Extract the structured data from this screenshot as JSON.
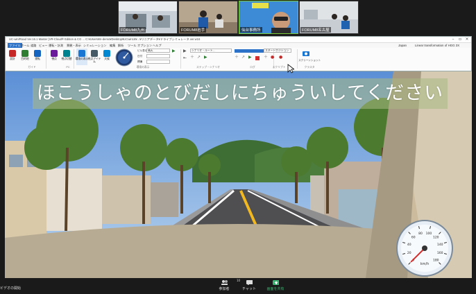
{
  "participants": [
    {
      "name": "FORUM8九州",
      "active": false
    },
    {
      "name": "FORUM8岩手",
      "active": false
    },
    {
      "name": "仙台事務所",
      "active": true
    },
    {
      "name": "FORUM8名古屋",
      "active": false
    }
  ],
  "app": {
    "title": "UC-win/Road Ver.16.1 Master [VR-Cloud® Edition & CG ... C:¥Users¥m-demo¥Desktop¥UCwin16¥...¥リニアデータ¥ドライブシミュレータ.ver.w16",
    "menu": [
      "ファイル",
      "ホーム",
      "道路",
      "ビュー",
      "運転・計測",
      "景観・表示",
      "シミュレーション",
      "編集",
      "解析",
      "ツール",
      "オプション",
      "ヘルプ"
    ],
    "selected_menu": "ファイル",
    "right_meta": {
      "lang": "Japan",
      "note": "Linear transformation of HGG 3X"
    },
    "ribbon": {
      "buttons": [
        {
          "label": "設計",
          "color": "#c62828"
        },
        {
          "label": "目的地",
          "color": "#2e7d32"
        },
        {
          "label": "運転",
          "color": "#1565c0"
        },
        {
          "label": "視点",
          "color": "#6a1b9a"
        },
        {
          "label": "視点切替",
          "color": "#00838f"
        },
        {
          "label": "交通",
          "color": "#ef6c00"
        },
        {
          "label": "環境の表示",
          "color": "#1976d2"
        },
        {
          "label": "視点アイテム",
          "color": "#455a64"
        },
        {
          "label": "天候",
          "color": "#0288d1"
        }
      ],
      "groups": [
        "ガイド",
        "PC",
        "環境の表示",
        "ステップ・シナリオ",
        "ログ",
        "スクリプト",
        "クラスタ"
      ],
      "fields": {
        "f1_label": "ビル表示",
        "f1_value": "晴天",
        "f2_label": "日付",
        "f2_value": "",
        "f3_label": "標識",
        "f3_value": "",
        "dropdown1": "シナリオ・ルート...",
        "dropdown2": "スタートポジション"
      },
      "right_button": "スクリーンショット"
    }
  },
  "scene": {
    "banner": "ほこうしゃのとびだしにちゅういしてください",
    "speedometer": {
      "unit": "km/h",
      "ticks": [
        "0",
        "20",
        "40",
        "60",
        "80",
        "100",
        "120",
        "140",
        "160",
        "180"
      ],
      "speed": 0
    }
  },
  "zoom": {
    "left_label": "ビデオの開始",
    "participants_count": "10",
    "items": [
      {
        "label": "参加者",
        "icon": "participants-icon"
      },
      {
        "label": "チャット",
        "icon": "chat-icon"
      },
      {
        "label": "画面を共有",
        "icon": "share-screen-icon",
        "color": "#3cb371"
      }
    ]
  }
}
